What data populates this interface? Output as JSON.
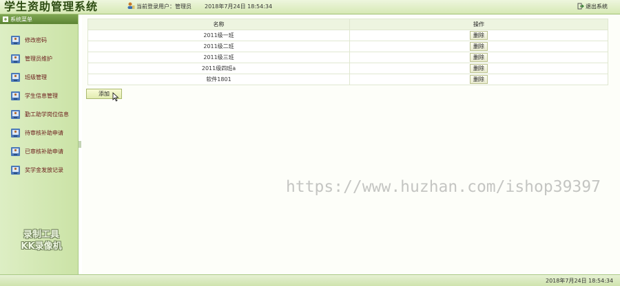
{
  "header": {
    "title": "学生资助管理系统",
    "user_label": "当前登录用户：管理员",
    "datetime": "2018年7月24日  18:54:34",
    "logout_label": "退出系统"
  },
  "sidebar": {
    "header": "系统菜单",
    "items": [
      {
        "label": "修改密码"
      },
      {
        "label": "管理员维护"
      },
      {
        "label": "班级管理"
      },
      {
        "label": "学生信息管理"
      },
      {
        "label": "勤工助学岗位信息"
      },
      {
        "label": "待审核补助申请"
      },
      {
        "label": "已审核补助申请"
      },
      {
        "label": "奖学金发放记录"
      }
    ],
    "watermark_line1": "录制工具",
    "watermark_line2": "KK录像机"
  },
  "table": {
    "headers": [
      "名称",
      "操作"
    ],
    "rows": [
      {
        "name": "2011级一班",
        "action": "删除"
      },
      {
        "name": "2011级二班",
        "action": "删除"
      },
      {
        "name": "2011级三班",
        "action": "删除"
      },
      {
        "name": "2011级四班a",
        "action": "删除"
      },
      {
        "name": "软件1801",
        "action": "删除"
      }
    ]
  },
  "add_button": "添加",
  "url_watermark": "https://www.huzhan.com/ishop39397",
  "footer": {
    "datetime": "2018年7月24日 18:54:34"
  }
}
